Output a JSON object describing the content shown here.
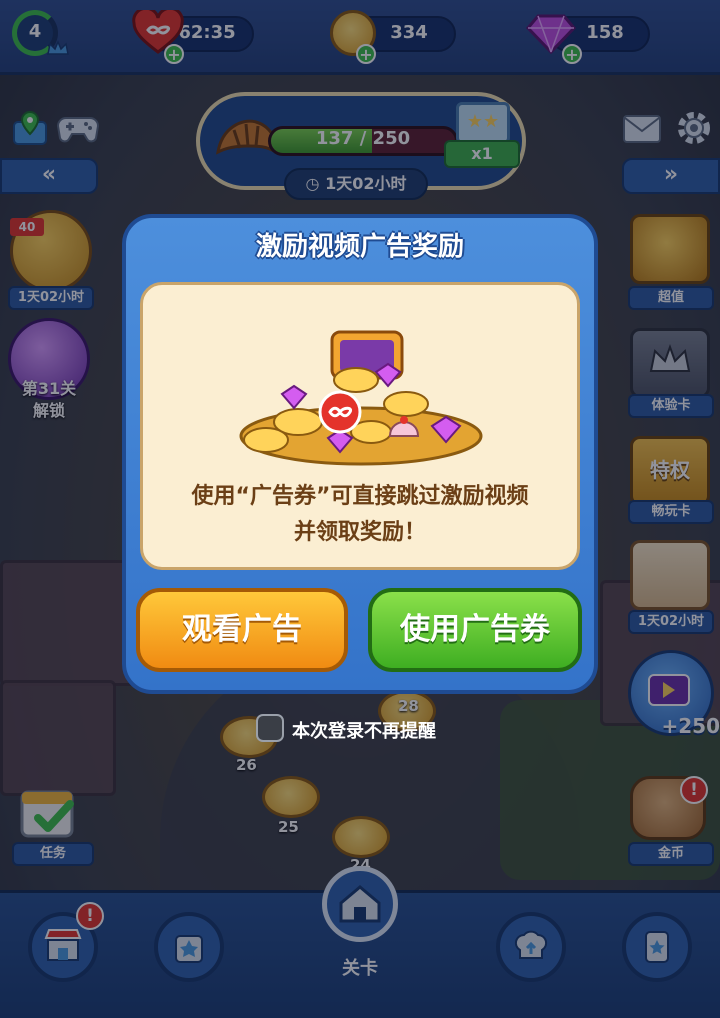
{
  "top_bar": {
    "level": "4",
    "lives_timer": "62:35",
    "coins": "334",
    "gems": "158"
  },
  "event": {
    "progress_text": "137 / 250",
    "progress_fraction": 0.548,
    "multiplier": "x1",
    "timer": "1天02小时"
  },
  "left_side": {
    "item1_label": "1天02小时",
    "item1_badge": "40",
    "item2_label_line1": "第31关",
    "item2_label_line2": "解锁",
    "task_label": "任务"
  },
  "right_side": {
    "item1_label": "超值",
    "item2_label": "体验卡",
    "item3_tile_text": "特权",
    "item3_label": "畅玩卡",
    "item4_label": "1天02小时",
    "video_reward": "+250",
    "coins_label": "金币"
  },
  "dialog": {
    "title": "激励视频广告奖励",
    "message_line1": "使用“广告券”可直接跳过激励视频",
    "message_line2": "并领取奖励！",
    "watch_button": "观看广告",
    "use_voucher_button": "使用广告券",
    "dont_remind_label": "本次登录不再提醒"
  },
  "map": {
    "path_numbers": [
      "28",
      "26",
      "25",
      "24"
    ]
  },
  "bottom_nav": {
    "active_label": "关卡",
    "alert_mark": "!"
  },
  "colors": {
    "dialog_blue": "#3f82d4",
    "panel_cream": "#fbeed2",
    "button_orange": "#f5a623",
    "button_green": "#55c22e",
    "accent_green": "#3cc04a"
  }
}
